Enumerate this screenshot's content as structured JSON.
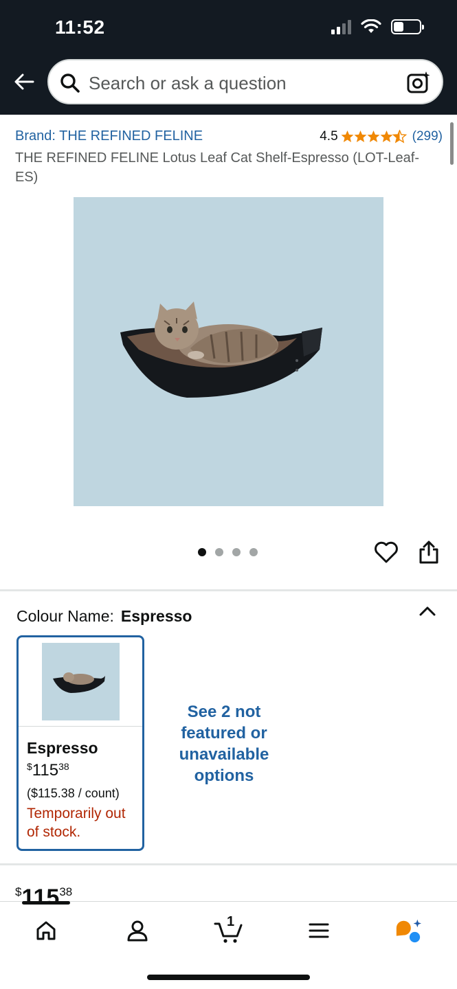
{
  "status_bar": {
    "time": "11:52"
  },
  "search": {
    "placeholder": "Search or ask a question"
  },
  "product": {
    "brand": "Brand: THE REFINED FELINE",
    "rating": "4.5",
    "review_count": "(299)",
    "stars_value": 4.5,
    "title": "THE REFINED FELINE Lotus Leaf Cat Shelf-Espresso (LOT-Leaf-ES)"
  },
  "gallery": {
    "image_count": 4,
    "active_index": 0
  },
  "colour": {
    "label": "Colour Name:",
    "selected": "Espresso",
    "option": {
      "name": "Espresso",
      "price_symbol": "$",
      "price_whole": "115",
      "price_fraction": "38",
      "unit_price": "($115.38 / count)",
      "stock": "Temporarily out of stock."
    },
    "see_more": "See 2 not featured or unavailable options"
  },
  "price_peek": {
    "symbol": "$",
    "whole": "115",
    "fraction": "38"
  },
  "bottom_nav": {
    "items": [
      "home-icon",
      "account-icon",
      "cart-icon",
      "menu-icon",
      "rufus-icon"
    ],
    "cart_count": "1"
  },
  "colors": {
    "header_bg": "#131a22",
    "link_blue": "#2162a1",
    "star_orange": "#f08804",
    "stock_red": "#b12704"
  }
}
